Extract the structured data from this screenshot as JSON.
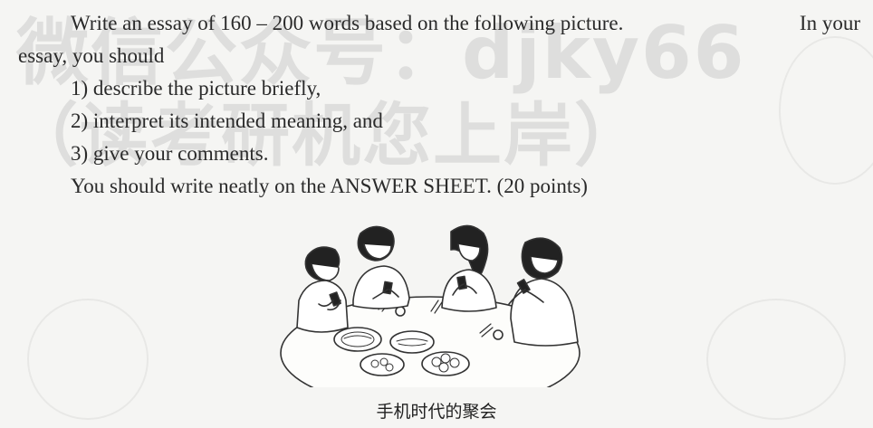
{
  "watermark": {
    "line1": "微信公众号：djky66",
    "line2": "（读考研机您上岸）"
  },
  "prompt": {
    "line1_part1": "Write an essay of 160 – 200 words based on the following picture.",
    "line1_part2": "In your",
    "line2": "essay, you should",
    "items": [
      "1) describe the picture briefly,",
      "2) interpret its intended meaning, and",
      "3) give your comments."
    ],
    "instruction": "You should write neatly on the ANSWER SHEET. (20 points)"
  },
  "figure": {
    "caption": "手机时代的聚会"
  },
  "colors": {
    "background": "#f5f5f3",
    "text": "#2a2a2a",
    "watermark": "#787878"
  }
}
